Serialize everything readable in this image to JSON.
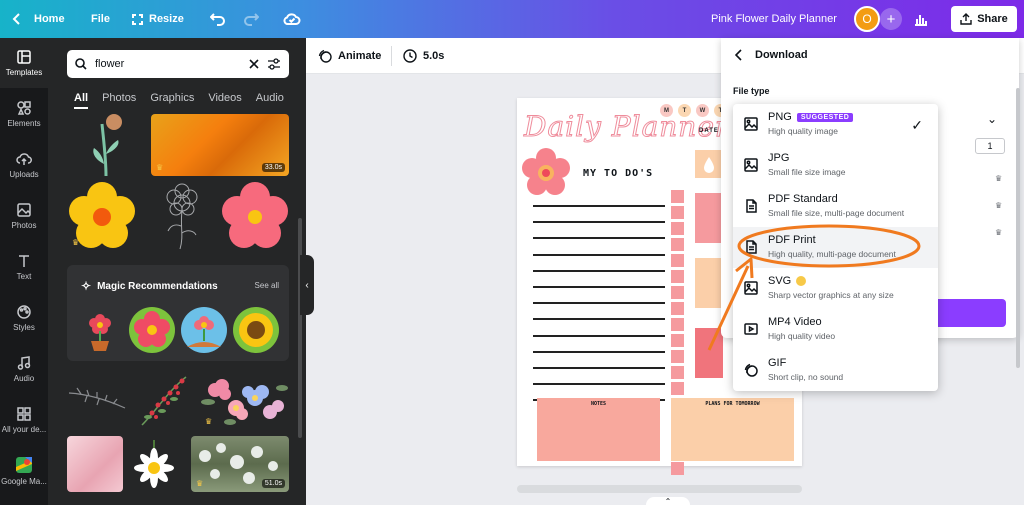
{
  "topbar": {
    "home_label": "Home",
    "file_label": "File",
    "resize_label": "Resize",
    "design_title": "Pink Flower Daily Planner",
    "avatar_initial": "O",
    "share_label": "Share",
    "gradient_start": "#17b3c9",
    "gradient_end": "#7d2ae8"
  },
  "rail": {
    "items": [
      {
        "label": "Templates",
        "icon": "templates-icon"
      },
      {
        "label": "Elements",
        "icon": "elements-icon"
      },
      {
        "label": "Uploads",
        "icon": "uploads-icon"
      },
      {
        "label": "Photos",
        "icon": "photos-icon"
      },
      {
        "label": "Text",
        "icon": "text-icon"
      },
      {
        "label": "Styles",
        "icon": "styles-icon"
      },
      {
        "label": "Audio",
        "icon": "audio-icon"
      },
      {
        "label": "All your de...",
        "icon": "apps-icon"
      },
      {
        "label": "Google Ma...",
        "icon": "google-maps-icon"
      }
    ]
  },
  "panel": {
    "search_value": "flower",
    "tabs": [
      "All",
      "Photos",
      "Graphics",
      "Videos",
      "Audio"
    ],
    "video_durations": [
      "33.0s",
      "51.0s"
    ],
    "magic_title": "Magic Recommendations",
    "see_all": "See all"
  },
  "editor": {
    "animate_label": "Animate",
    "duration_label": "5.0s"
  },
  "page": {
    "title": "Daily Planner",
    "weekdays": [
      "M",
      "T",
      "W",
      "T"
    ],
    "date_label": "DATE",
    "todo_title": "MY TO DO'S",
    "notes_label": "NOTES",
    "plans_label": "PLANS FOR TOMORROW",
    "accent_pink": "#f59a9e",
    "accent_peach": "#fbcfa9"
  },
  "download": {
    "title": "Download",
    "file_type_label": "File type",
    "quantity": "1",
    "button_color": "#8b3dff"
  },
  "file_types": [
    {
      "name": "PNG",
      "desc": "High quality image",
      "badge": "SUGGESTED",
      "selected": true,
      "icon": "image-icon"
    },
    {
      "name": "JPG",
      "desc": "Small file size image",
      "icon": "image-icon"
    },
    {
      "name": "PDF Standard",
      "desc": "Small file size, multi-page document",
      "icon": "document-icon"
    },
    {
      "name": "PDF Print",
      "desc": "High quality, multi-page document",
      "highlighted": true,
      "icon": "document-icon"
    },
    {
      "name": "SVG",
      "desc": "Sharp vector graphics at any size",
      "pro": true,
      "icon": "image-icon"
    },
    {
      "name": "MP4 Video",
      "desc": "High quality video",
      "icon": "video-icon"
    },
    {
      "name": "GIF",
      "desc": "Short clip, no sound",
      "icon": "gif-icon"
    }
  ],
  "annotation": {
    "color": "#f07a1f"
  }
}
